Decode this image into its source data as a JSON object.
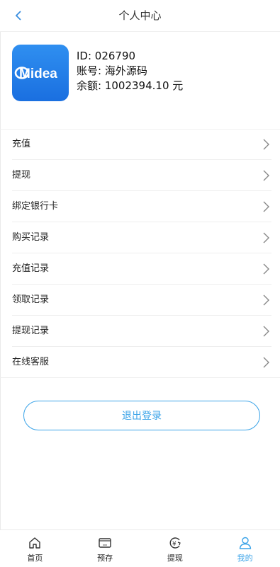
{
  "header": {
    "title": "个人中心"
  },
  "profile": {
    "logo_text": "Midea",
    "id_text": "ID: 026790",
    "account_text": "账号: 海外源码",
    "balance_text": "余额: 1002394.10 元"
  },
  "menu": [
    {
      "label": "充值"
    },
    {
      "label": "提现"
    },
    {
      "label": "绑定银行卡"
    },
    {
      "label": "购买记录"
    },
    {
      "label": "充值记录"
    },
    {
      "label": "领取记录"
    },
    {
      "label": "提现记录"
    },
    {
      "label": "在线客服"
    }
  ],
  "logout_label": "退出登录",
  "tabs": [
    {
      "label": "首页",
      "icon": "home-icon"
    },
    {
      "label": "预存",
      "icon": "card-icon"
    },
    {
      "label": "提现",
      "icon": "withdraw-icon"
    },
    {
      "label": "我的",
      "icon": "user-icon",
      "active": true
    }
  ],
  "colors": {
    "accent": "#3aa3e8",
    "logo_bg": "#1f7fe8"
  }
}
